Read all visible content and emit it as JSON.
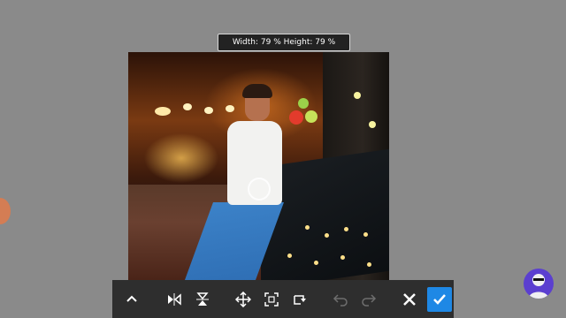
{
  "size_readout": "Width: 79 % Height: 79 %",
  "colors": {
    "background": "#8a8a8a",
    "toolbar": "#2e2e2e",
    "confirm_accent": "#1e88e5",
    "icon": "#ffffff",
    "icon_disabled": "#6e6e6e"
  },
  "toolbar": {
    "buttons": [
      {
        "name": "collapse-toolbar-button",
        "icon": "chevron-up-icon",
        "enabled": true
      },
      {
        "name": "flip-horizontal-button",
        "icon": "flip-horizontal-icon",
        "enabled": true
      },
      {
        "name": "flip-vertical-button",
        "icon": "flip-vertical-icon",
        "enabled": true
      },
      {
        "name": "move-button",
        "icon": "move-arrows-icon",
        "enabled": true
      },
      {
        "name": "fit-screen-button",
        "icon": "fit-frame-icon",
        "enabled": true
      },
      {
        "name": "rotate-button",
        "icon": "rotate-icon",
        "enabled": true
      },
      {
        "name": "undo-button",
        "icon": "undo-icon",
        "enabled": false
      },
      {
        "name": "redo-button",
        "icon": "redo-icon",
        "enabled": false
      },
      {
        "name": "cancel-button",
        "icon": "close-icon",
        "enabled": true
      },
      {
        "name": "apply-button",
        "icon": "checkmark-icon",
        "enabled": true
      }
    ]
  }
}
